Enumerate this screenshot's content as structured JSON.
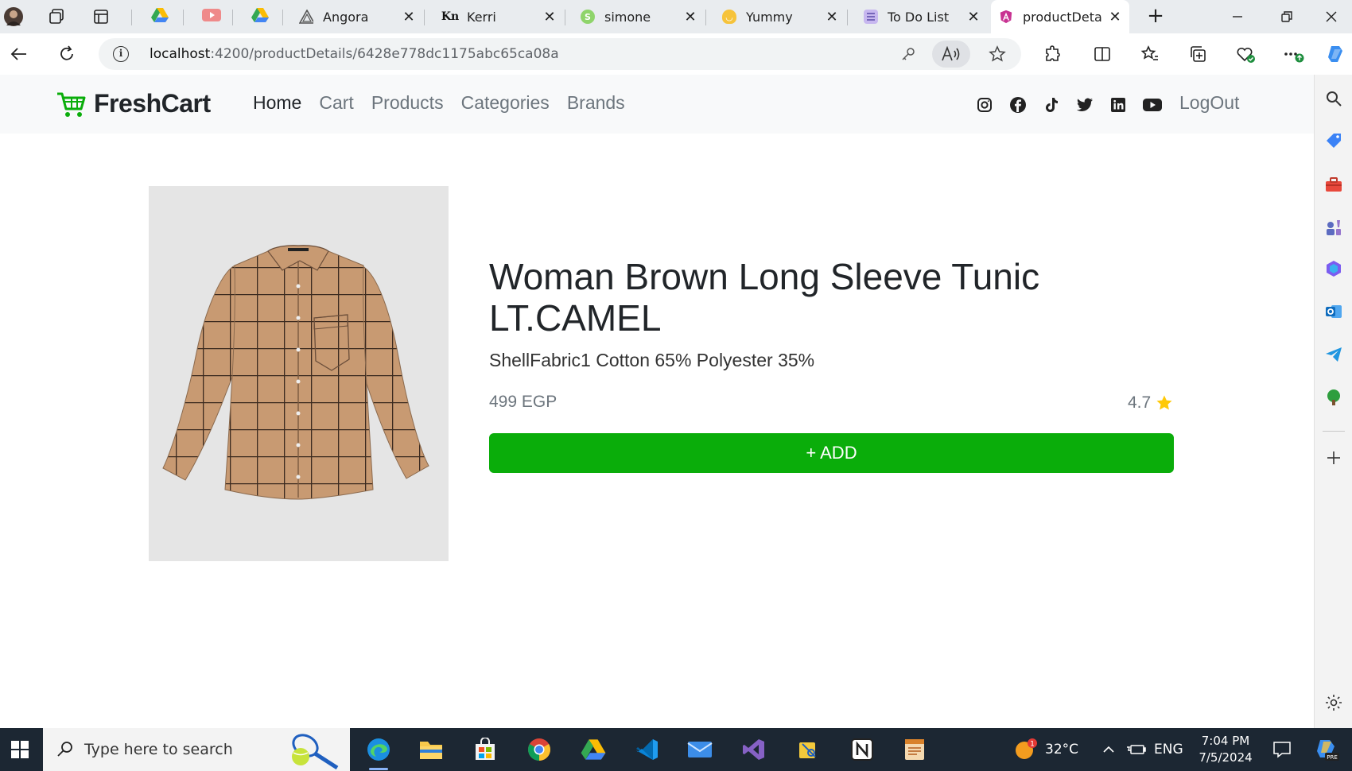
{
  "browser": {
    "tabs": [
      {
        "title": "",
        "favicon": "google-drive-icon",
        "closable": false
      },
      {
        "title": "",
        "favicon": "youtube-icon",
        "closable": false
      },
      {
        "title": "",
        "favicon": "google-drive-icon",
        "closable": false
      },
      {
        "title": "Angora",
        "favicon": "angora-icon",
        "closable": true
      },
      {
        "title": "Kerri",
        "favicon": "kerri-icon",
        "closable": true
      },
      {
        "title": "simone",
        "favicon": "simone-icon",
        "closable": true
      },
      {
        "title": "Yummy",
        "favicon": "yummy-icon",
        "closable": true
      },
      {
        "title": "To Do List",
        "favicon": "todo-icon",
        "closable": true
      },
      {
        "title": "productDeta",
        "favicon": "angular-icon",
        "closable": true,
        "active": true
      }
    ],
    "url_host": "localhost",
    "url_path": ":4200/productDetails/6428e778dc1175abc65ca08a",
    "read_aloud_label": "A̅"
  },
  "navbar": {
    "brand": "FreshCart",
    "links": [
      {
        "label": "Home",
        "active": true
      },
      {
        "label": "Cart",
        "active": false
      },
      {
        "label": "Products",
        "active": false
      },
      {
        "label": "Categories",
        "active": false
      },
      {
        "label": "Brands",
        "active": false
      }
    ],
    "social_icons": [
      "instagram-icon",
      "facebook-icon",
      "tiktok-icon",
      "twitter-icon",
      "linkedin-icon",
      "youtube-icon"
    ],
    "logout_label": "LogOut"
  },
  "product": {
    "title": "Woman Brown Long Sleeve Tunic LT.CAMEL",
    "description": "ShellFabric1 Cotton 65% Polyester 35%",
    "price": "499 EGP",
    "rating": "4.7",
    "add_label": "+ ADD"
  },
  "taskbar": {
    "search_placeholder": "Type here to search",
    "weather": "32°C",
    "language": "ENG",
    "time": "7:04 PM",
    "date": "7/5/2024",
    "notification_count": "1"
  },
  "colors": {
    "brand_green": "#0aad0a",
    "navbar_bg": "#f8f9fa",
    "star": "#ffc908"
  }
}
